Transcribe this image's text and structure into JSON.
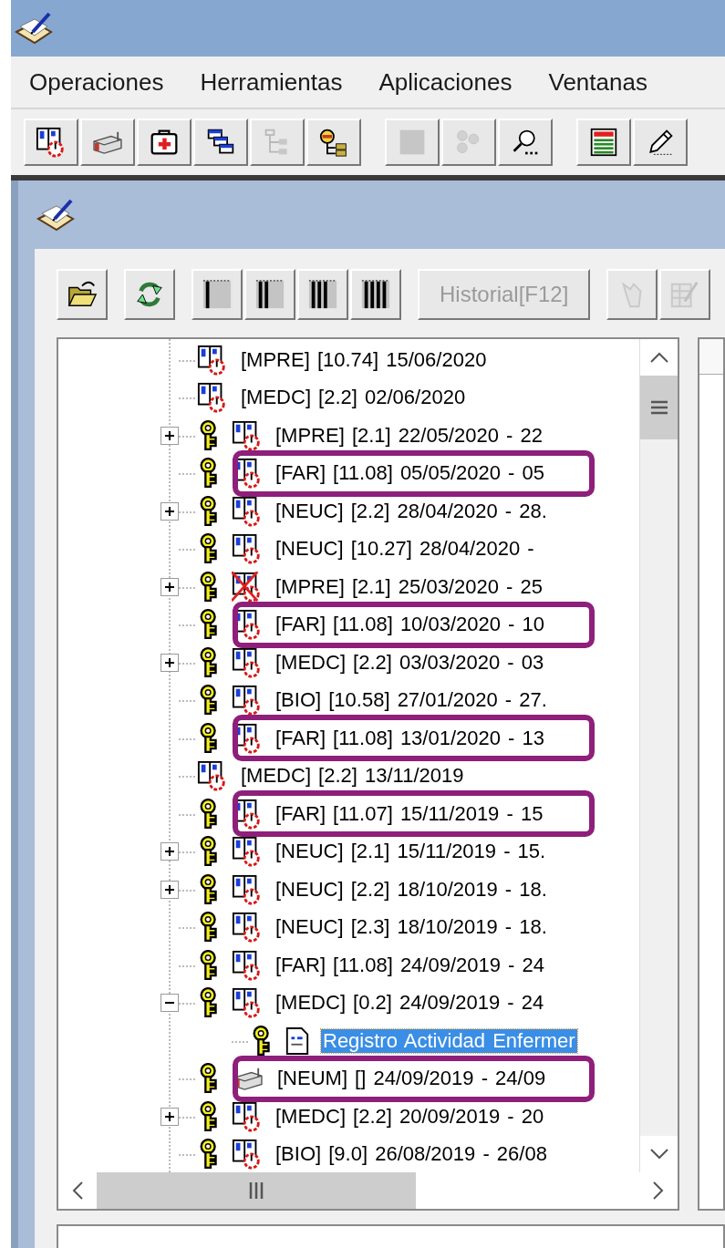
{
  "menu": [
    {
      "label": "Operaciones"
    },
    {
      "label": "Herramientas"
    },
    {
      "label": "Aplicaciones"
    },
    {
      "label": "Ventanas"
    }
  ],
  "toolbar": [
    {
      "kind": "record",
      "disabled": false
    },
    {
      "kind": "bed",
      "disabled": false
    },
    {
      "kind": "first-aid",
      "disabled": false
    },
    {
      "kind": "windows",
      "disabled": false
    },
    {
      "kind": "tree",
      "disabled": true
    },
    {
      "kind": "person-folders",
      "disabled": false
    },
    {
      "kind": "square",
      "disabled": true
    },
    {
      "kind": "circles",
      "disabled": true
    },
    {
      "kind": "search",
      "disabled": false
    },
    {
      "kind": "grid",
      "disabled": false
    },
    {
      "kind": "pen",
      "disabled": false
    }
  ],
  "inner_toolbar": [
    {
      "kind": "open",
      "disabled": false
    },
    {
      "kind": "refresh",
      "disabled": false
    },
    {
      "kind": "bars1",
      "disabled": false
    },
    {
      "kind": "bars2",
      "disabled": false
    },
    {
      "kind": "bars3",
      "disabled": false
    },
    {
      "kind": "bars4",
      "disabled": false
    },
    {
      "kind": "text",
      "label": "Historial[F12]",
      "disabled": true
    },
    {
      "kind": "hand",
      "disabled": true
    },
    {
      "kind": "edit-grid",
      "disabled": true
    }
  ],
  "tree": {
    "rows": [
      {
        "text": "[MPRE] [10.74] 15/06/2020",
        "key": false,
        "kind": "record",
        "highlighted": false
      },
      {
        "text": "[MEDC] [2.2] 02/06/2020",
        "key": false,
        "kind": "record",
        "highlighted": false
      },
      {
        "text": "[MPRE] [2.1] 22/05/2020 - 22",
        "key": true,
        "kind": "record",
        "expanded": false,
        "highlighted": false
      },
      {
        "text": "[FAR] [11.08] 05/05/2020 - 05",
        "key": true,
        "kind": "record",
        "highlighted": true
      },
      {
        "text": "[NEUC] [2.2] 28/04/2020 - 28.",
        "key": true,
        "kind": "record",
        "expanded": false,
        "highlighted": false
      },
      {
        "text": "[NEUC] [10.27] 28/04/2020 -",
        "key": true,
        "kind": "record",
        "highlighted": false
      },
      {
        "text": "[MPRE] [2.1] 25/03/2020 - 25",
        "key": true,
        "kind": "cancelled",
        "expanded": false,
        "highlighted": false
      },
      {
        "text": "[FAR] [11.08] 10/03/2020 - 10",
        "key": true,
        "kind": "record",
        "highlighted": true
      },
      {
        "text": "[MEDC] [2.2] 03/03/2020 - 03",
        "key": true,
        "kind": "record",
        "expanded": false,
        "highlighted": false
      },
      {
        "text": "[BIO] [10.58] 27/01/2020 - 27.",
        "key": true,
        "kind": "record",
        "highlighted": false
      },
      {
        "text": "[FAR] [11.08] 13/01/2020 - 13",
        "key": true,
        "kind": "record",
        "highlighted": true
      },
      {
        "text": "[MEDC] [2.2] 13/11/2019",
        "key": false,
        "kind": "record",
        "highlighted": false
      },
      {
        "text": "[FAR] [11.07] 15/11/2019 - 15",
        "key": true,
        "kind": "record",
        "highlighted": true
      },
      {
        "text": "[NEUC] [2.1] 15/11/2019 - 15.",
        "key": true,
        "kind": "record",
        "expanded": false,
        "highlighted": false
      },
      {
        "text": "[NEUC] [2.2] 18/10/2019 - 18.",
        "key": true,
        "kind": "record",
        "expanded": false,
        "highlighted": false
      },
      {
        "text": "[NEUC] [2.3] 18/10/2019 - 18.",
        "key": true,
        "kind": "record",
        "highlighted": false
      },
      {
        "text": "[FAR] [11.08] 24/09/2019 - 24",
        "key": true,
        "kind": "record",
        "highlighted": false
      },
      {
        "text": "[MEDC] [0.2] 24/09/2019 - 24",
        "key": true,
        "kind": "record",
        "expanded": true,
        "highlighted": false,
        "children": [
          {
            "text": "Registro Actividad Enfermer",
            "key": true,
            "kind": "document",
            "selected": true
          }
        ]
      },
      {
        "text": "[NEUM] [] 24/09/2019 - 24/09",
        "key": true,
        "kind": "bed",
        "highlighted": true
      },
      {
        "text": "[MEDC] [2.2] 20/09/2019 - 20",
        "key": true,
        "kind": "record",
        "expanded": false,
        "highlighted": false
      },
      {
        "text": "[BIO] [9.0] 26/08/2019 - 26/08",
        "key": true,
        "kind": "record",
        "highlighted": false
      }
    ]
  }
}
